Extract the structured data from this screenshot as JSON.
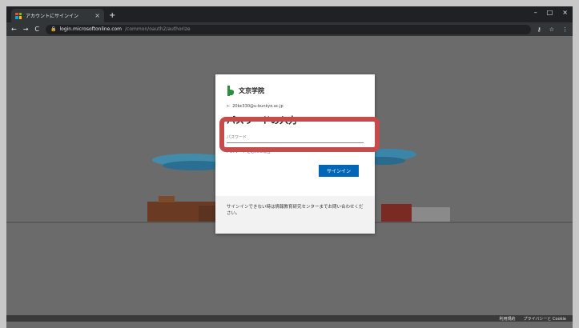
{
  "browser": {
    "tab_title": "アカウントにサインイン",
    "tab_close": "×",
    "new_tab": "+",
    "win_minimize": "–",
    "win_maximize": "□",
    "win_close": "×",
    "url_host": "login.microsoftonline.com",
    "url_path": "/common/oauth2/authorize",
    "favicon_colors": [
      "#f25022",
      "#7fba00",
      "#00a4ef",
      "#ffb900"
    ]
  },
  "card": {
    "org_name": "文京学院",
    "account_email": "20bc330@u-bunkyo.ac.jp",
    "back_arrow": "←",
    "heading": "パスワードの入力",
    "password_placeholder": "パスワード",
    "forgot_link": "パスワードを忘れた場合",
    "signin_label": "サインイン",
    "footer_text": "サインインできない時は情報教育研究センターまでお問い合わせください。",
    "logo_color": "#2e8b3e",
    "button_color": "#0067b8"
  },
  "footer": {
    "terms": "利用規約",
    "privacy": "プライバシーと Cookie"
  },
  "highlight_color": "#c64b4b"
}
